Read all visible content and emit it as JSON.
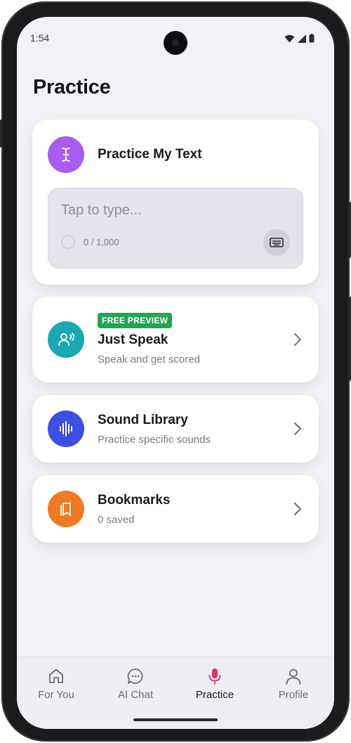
{
  "status_bar": {
    "time": "1:54"
  },
  "page": {
    "title": "Practice"
  },
  "practice_text": {
    "title": "Practice My Text",
    "placeholder": "Tap to type...",
    "counter": "0 / 1,000",
    "icon": "text-cursor-icon",
    "color": "#a95cf0"
  },
  "cards": [
    {
      "badge": "FREE PREVIEW",
      "title": "Just Speak",
      "subtitle": "Speak and get scored",
      "icon": "speaking-person-icon",
      "color": "#1aa9b2"
    },
    {
      "title": "Sound Library",
      "subtitle": "Practice specific sounds",
      "icon": "sound-wave-icon",
      "color": "#3d4fe0"
    },
    {
      "title": "Bookmarks",
      "subtitle": "0 saved",
      "icon": "bookmark-icon",
      "color": "#f07a23"
    }
  ],
  "bottom_nav": {
    "items": [
      {
        "label": "For You",
        "icon": "home-icon",
        "active": false
      },
      {
        "label": "AI Chat",
        "icon": "chat-bubble-icon",
        "active": false
      },
      {
        "label": "Practice",
        "icon": "microphone-icon",
        "active": true
      },
      {
        "label": "Profile",
        "icon": "profile-icon",
        "active": false
      }
    ],
    "active_color": "#e0345a"
  }
}
